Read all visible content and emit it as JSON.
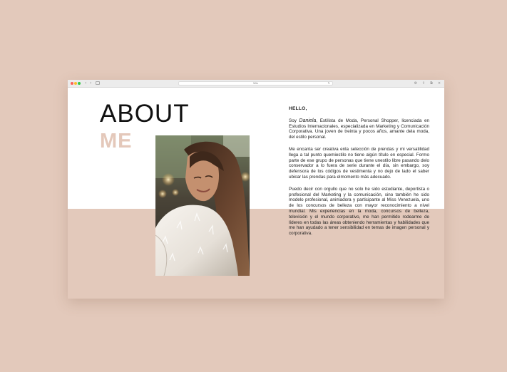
{
  "browser": {
    "tab_title": "Wix",
    "nav_back": "‹",
    "nav_forward": "›",
    "reload": "↻",
    "share": "⇧",
    "tabs": "⧉",
    "settings": "⚙",
    "close": "×"
  },
  "about": {
    "title_line1": "ABOUT",
    "title_line2": "ME",
    "hello": "HELLO,",
    "p1_prefix": "Soy",
    "p1_name": "Daniela",
    "p1_rest": ", Estilista de Moda, Personal Shopper, licenciada en Estudios Internacionales, especializada en Marketing y Comunicación Corporativa. Una joven de treinta y pocos años, amante dela moda, del estilo personal.",
    "p2": "Me encanta ser creativa enla selección de prendas y mi versatilidad llega a tal punto quemiestilo no tiene algún título en especial. Formo parte de ese grupo de personas que tiene unestilo libre pasando delo conservador a lo fuera de serie durante el día, sin embargo, soy defensora de los códigos de vestimenta y no dejo de lado el saber ubicar las prendas para elmomento más adecuado.",
    "p3": "Puedo decir con orgullo que no solo he sido estudiante, deportista o profesional del Marketing y la comunicación, sino también he sido modelo profesional, animadora y participante al Miss Venezuela, uno de los concursos de belleza con mayor reconocimiento a nivel mundial. Mis experiencias en la moda, concursos de belleza, televisión y el mundo corporativo, me han permitido rodearme de líderes en todas las áreas obteniendo herramientas y habilidades que me han ayudado a tener sensibilidad en temas de imagen personal y corporativa."
  },
  "colors": {
    "background": "#e3c9bb",
    "accent": "#e4c8ba",
    "text": "#111111"
  },
  "icons": {
    "photo": "portrait-photo-white-fur-coat"
  }
}
